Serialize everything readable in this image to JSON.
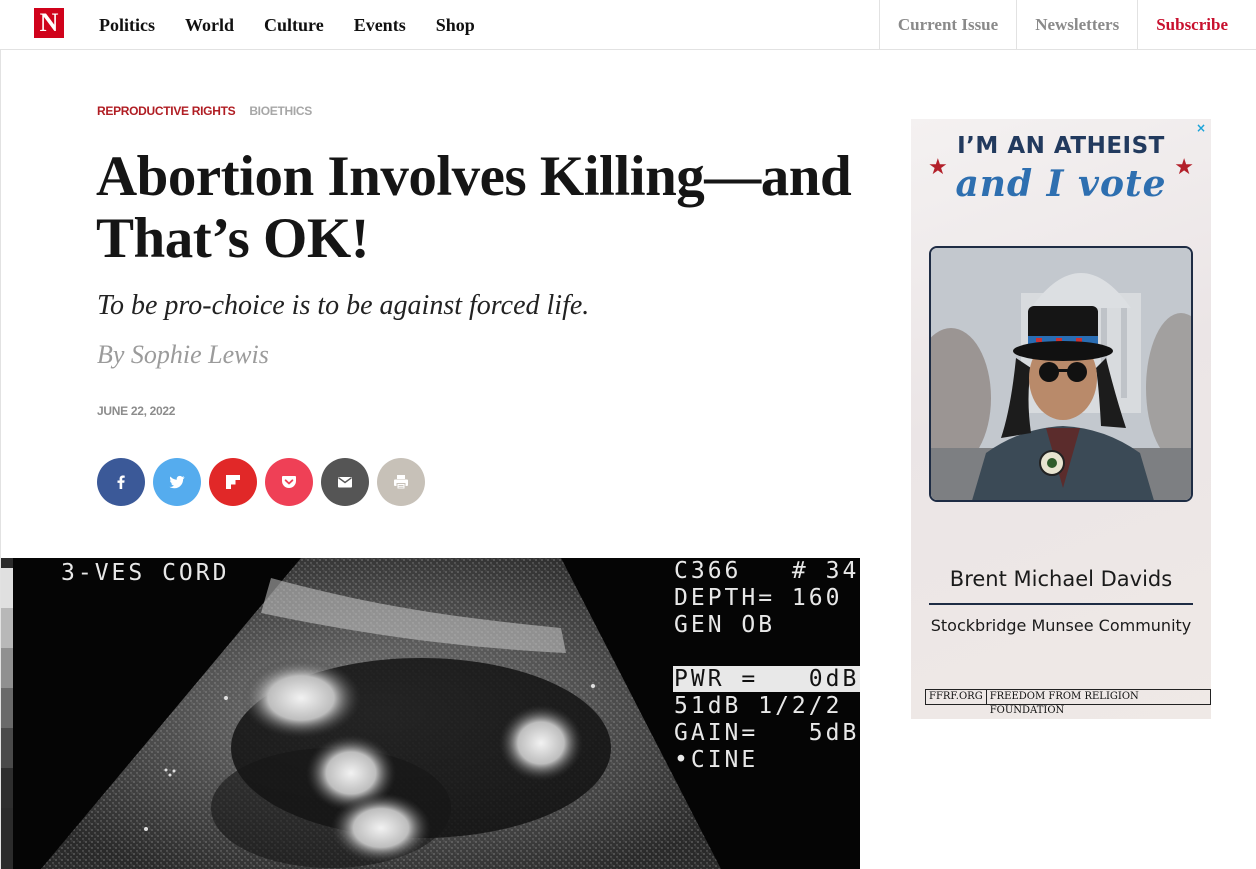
{
  "nav": {
    "logo": "N",
    "left_items": [
      "Politics",
      "World",
      "Culture",
      "Events",
      "Shop"
    ],
    "right_items": {
      "current_issue": "Current Issue",
      "newsletters": "Newsletters",
      "subscribe": "Subscribe"
    }
  },
  "article": {
    "tags": [
      "REPRODUCTIVE RIGHTS",
      "BIOETHICS"
    ],
    "headline": "Abortion Involves Killing—and That’s OK!",
    "dek": "To be pro-choice is to be against forced life.",
    "byline": "By Sophie Lewis",
    "date": "JUNE 22, 2022"
  },
  "share_buttons": [
    {
      "name": "facebook",
      "color": "#3b5998"
    },
    {
      "name": "twitter",
      "color": "#55acee"
    },
    {
      "name": "flipboard",
      "color": "#e12828"
    },
    {
      "name": "pocket",
      "color": "#ef4056"
    },
    {
      "name": "email",
      "color": "#555555"
    },
    {
      "name": "print",
      "color": "#c7c1b8"
    }
  ],
  "hero_image": {
    "overlay_left": "3-VES CORD",
    "overlay_right_1": "C366   # 34",
    "overlay_right_2": "DEPTH= 160",
    "overlay_right_3": "GEN OB",
    "overlay_right_4": "PWR =   0dB",
    "overlay_right_5": "51dB 1/2/2",
    "overlay_right_6": "GAIN=   5dB",
    "overlay_right_7": "•CINE"
  },
  "ad": {
    "close_icon": "×",
    "line1": "I’M AN ATHEIST",
    "line2": "and I vote",
    "name": "Brent Michael Davids",
    "community": "Stockbridge Munsee Community",
    "footer_left": "FFRF.ORG",
    "footer_right": "FREEDOM FROM RELIGION FOUNDATION",
    "accent_colors": {
      "navy": "#223a5e",
      "blue": "#2e6fb0",
      "red": "#b3202a"
    }
  }
}
